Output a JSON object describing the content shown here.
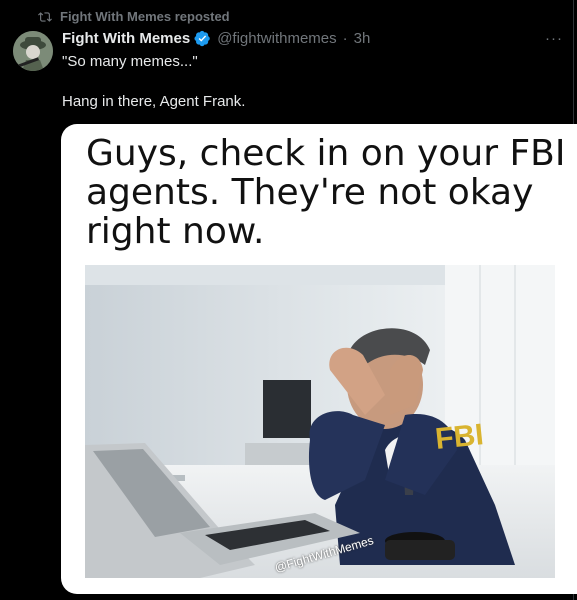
{
  "repost": {
    "label": "Fight With Memes reposted",
    "icon": "repost-icon"
  },
  "author": {
    "name": "Fight With Memes",
    "handle": "@fightwithmemes",
    "separator": "·",
    "time": "3h",
    "verified": true,
    "avatar_icon": "avatar-image"
  },
  "menu": {
    "label": "···"
  },
  "post": {
    "line1": "\"So many memes...\"",
    "line2": "Hang in there, Agent Frank."
  },
  "media": {
    "caption": "Guys, check in on your FBI agents. They're not okay right now.",
    "jacket_text": "FBI",
    "watermark": "@FightWithMemes"
  },
  "colors": {
    "background": "#000000",
    "text": "#e7e9ea",
    "muted": "#71767b",
    "verified": "#1d9bf0"
  }
}
